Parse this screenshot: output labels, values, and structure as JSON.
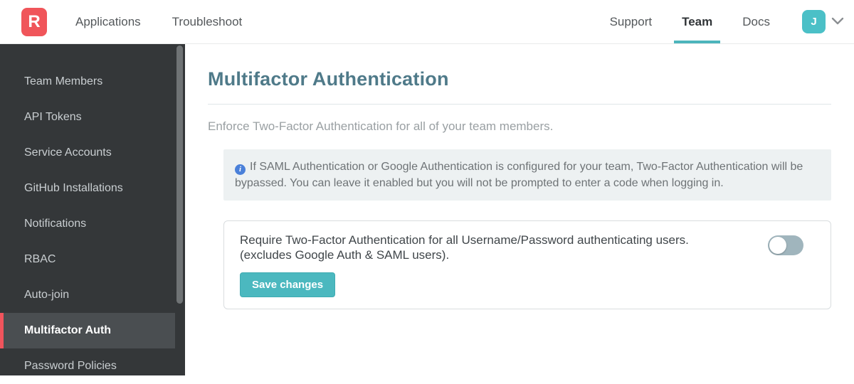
{
  "brand": {
    "logo_letter": "R"
  },
  "header": {
    "nav_left": [
      {
        "label": "Applications"
      },
      {
        "label": "Troubleshoot"
      }
    ],
    "nav_right": [
      {
        "label": "Support",
        "active": false
      },
      {
        "label": "Team",
        "active": true
      },
      {
        "label": "Docs",
        "active": false
      }
    ],
    "avatar_initial": "J"
  },
  "sidebar": {
    "items": [
      {
        "label": "Team Members",
        "active": false
      },
      {
        "label": "API Tokens",
        "active": false
      },
      {
        "label": "Service Accounts",
        "active": false
      },
      {
        "label": "GitHub Installations",
        "active": false
      },
      {
        "label": "Notifications",
        "active": false
      },
      {
        "label": "RBAC",
        "active": false
      },
      {
        "label": "Auto-join",
        "active": false
      },
      {
        "label": "Multifactor Auth",
        "active": true
      },
      {
        "label": "Password Policies",
        "active": false
      }
    ]
  },
  "main": {
    "title": "Multifactor Authentication",
    "description": "Enforce Two-Factor Authentication for all of your team members.",
    "info_icon_glyph": "i",
    "info_note": "If SAML Authentication or Google Authentication is configured for your team, Two-Factor Authentication will be bypassed. You can leave it enabled but you will not be prompted to enter a code when logging in.",
    "setting": {
      "line1": "Require Two-Factor Authentication for all Username/Password authenticating users.",
      "line2": "(excludes Google Auth & SAML users).",
      "toggle_state": "off",
      "save_label": "Save changes"
    }
  },
  "colors": {
    "accent_teal": "#4bb8bf",
    "accent_red": "#f0555a",
    "heading_teal": "#4f7a89"
  }
}
